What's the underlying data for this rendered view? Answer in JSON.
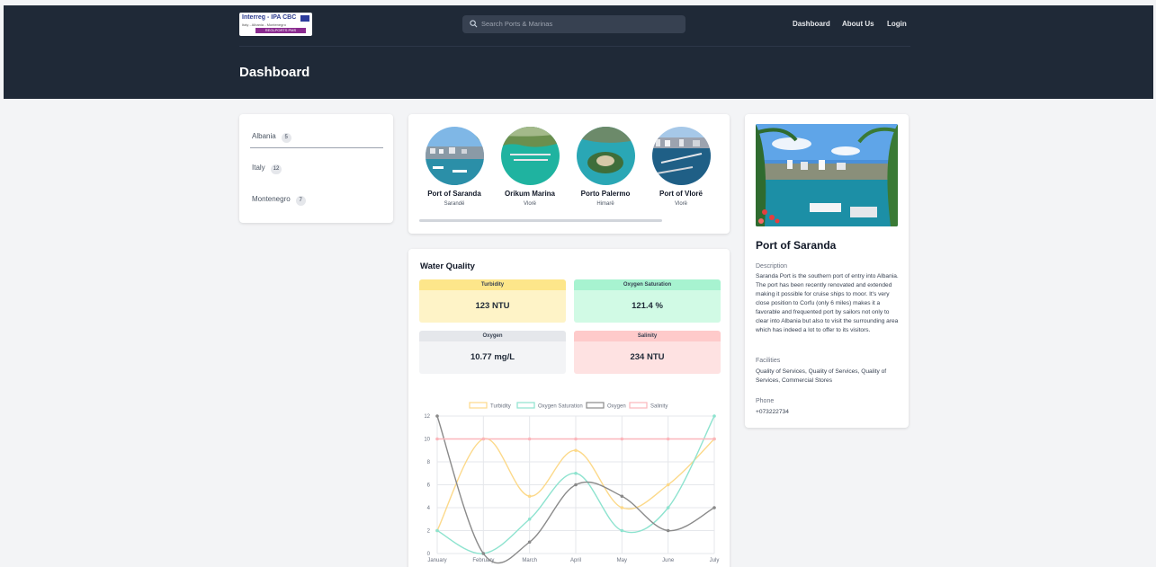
{
  "header": {
    "logo": {
      "line1": "Interreg - IPA CBC",
      "line2": "Italy - Albania - Montenegro",
      "line3": "REGLPORTS PMS"
    },
    "search_placeholder": "Search Ports & Marinas",
    "nav": [
      "Dashboard",
      "About Us",
      "Login"
    ],
    "page_title": "Dashboard"
  },
  "countries": [
    {
      "name": "Albania",
      "count": "5"
    },
    {
      "name": "Italy",
      "count": "12"
    },
    {
      "name": "Montenegro",
      "count": "7"
    }
  ],
  "ports": [
    {
      "name": "Port of Saranda",
      "city": "Sarandë"
    },
    {
      "name": "Orikum Marina",
      "city": "Vlorë"
    },
    {
      "name": "Porto Palermo",
      "city": "Himarë"
    },
    {
      "name": "Port of Vlorë",
      "city": "Vlorë"
    }
  ],
  "water_quality": {
    "title": "Water Quality",
    "metrics": [
      {
        "label": "Turbidity",
        "value": "123 NTU",
        "header_color": "#fde68a",
        "body_color": "#fef3c7"
      },
      {
        "label": "Oxygen Saturation",
        "value": "121.4 %",
        "header_color": "#a7f3d0",
        "body_color": "#d1fae5"
      },
      {
        "label": "Oxygen",
        "value": "10.77 mg/L",
        "header_color": "#e5e7eb",
        "body_color": "#f3f4f6"
      },
      {
        "label": "Salinity",
        "value": "234 NTU",
        "header_color": "#fecaca",
        "body_color": "#fee2e2"
      }
    ]
  },
  "chart_data": {
    "type": "line",
    "categories": [
      "January",
      "February",
      "March",
      "April",
      "May",
      "June",
      "July"
    ],
    "ylim": [
      0,
      12
    ],
    "yticks": [
      0,
      2,
      4,
      6,
      8,
      10,
      12
    ],
    "grid": true,
    "legend_position": "top",
    "series": [
      {
        "name": "Turbidity",
        "values": [
          2,
          10,
          5,
          9,
          4,
          6,
          10
        ],
        "color": "#fcd98a"
      },
      {
        "name": "Oxygen Saturation",
        "values": [
          2,
          0,
          3,
          7,
          2,
          4,
          12
        ],
        "color": "#8ee3cf"
      },
      {
        "name": "Oxygen",
        "values": [
          12,
          0,
          1,
          6,
          5,
          2,
          4
        ],
        "color": "#8a8a8a"
      },
      {
        "name": "Salinity",
        "values": [
          10,
          10,
          10,
          10,
          10,
          10,
          10
        ],
        "color": "#fbb6bb"
      }
    ]
  },
  "detail": {
    "title": "Port of Saranda",
    "description_label": "Description",
    "description": "Saranda Port is the southern port of entry into Albania. The port has been recently renovated and extended making it possible for cruise ships to moor. It's very close position to Corfu (only 6 miles) makes it a favorable and frequented port by sailors not only to clear into Albania but also to visit the surrounding area which has indeed a lot to offer to its visitors.",
    "facilities_label": "Facilities",
    "facilities": "Quality of Services, Quality of Services, Quality of Services, Commercial Stores",
    "phone_label": "Phone",
    "phone": "+073222734"
  }
}
